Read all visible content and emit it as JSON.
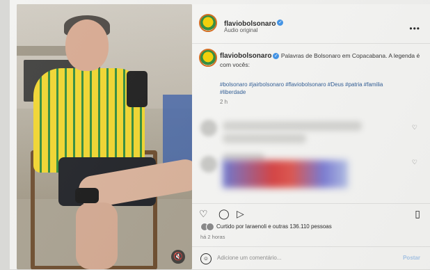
{
  "post": {
    "username": "flaviobolsonaro",
    "audio": "Áudio original",
    "caption_text": "Palavras de Bolsonaro em Copacabana. A legenda é com vocês:",
    "hashtags": "#bolsonaro #jairbolsonaro #flaviobolsonaro #Deus #patria #familia #liberdade",
    "age": "2 h",
    "likes_text": "Curtido por laraenoli e outras 136.110 pessoas",
    "time_text": "há 2 horas",
    "comment_placeholder": "Adicione um comentário...",
    "post_label": "Postar"
  },
  "icons": {
    "more": "more-icon",
    "heart": "heart-icon",
    "comment": "comment-icon",
    "share": "share-icon",
    "save": "bookmark-icon",
    "emoji": "emoji-icon",
    "mute": "speaker-muted-icon"
  },
  "colors": {
    "link": "#2d5b95",
    "verified": "#3d92e8"
  }
}
